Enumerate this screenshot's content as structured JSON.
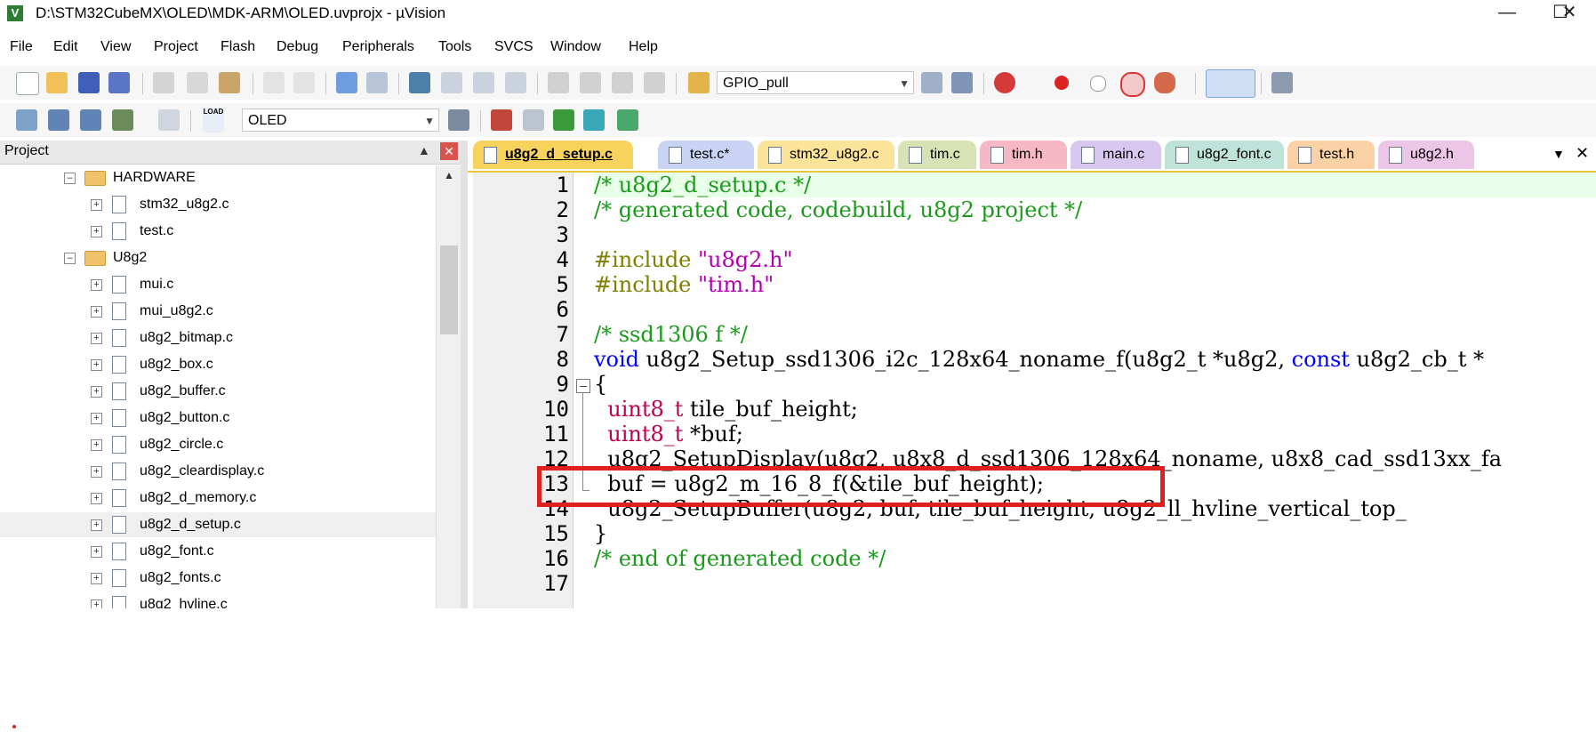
{
  "window": {
    "title": "D:\\STM32CubeMX\\OLED\\MDK-ARM\\OLED.uvprojx - µVision",
    "minimize": "—",
    "maximize": "☐",
    "close": "✕"
  },
  "menu": [
    "File",
    "Edit",
    "View",
    "Project",
    "Flash",
    "Debug",
    "Peripherals",
    "Tools",
    "SVCS",
    "Window",
    "Help"
  ],
  "toolbar1": {
    "find_combo": "GPIO_pull"
  },
  "toolbar2": {
    "target_combo": "OLED",
    "load_label": "LOAD"
  },
  "project_panel": {
    "title": "Project",
    "tree": [
      {
        "label": "HARDWARE",
        "type": "folder"
      },
      {
        "label": "stm32_u8g2.c",
        "type": "file"
      },
      {
        "label": "test.c",
        "type": "file"
      },
      {
        "label": "U8g2",
        "type": "folder"
      },
      {
        "label": "mui.c",
        "type": "file"
      },
      {
        "label": "mui_u8g2.c",
        "type": "file"
      },
      {
        "label": "u8g2_bitmap.c",
        "type": "file"
      },
      {
        "label": "u8g2_box.c",
        "type": "file"
      },
      {
        "label": "u8g2_buffer.c",
        "type": "file"
      },
      {
        "label": "u8g2_button.c",
        "type": "file"
      },
      {
        "label": "u8g2_circle.c",
        "type": "file"
      },
      {
        "label": "u8g2_cleardisplay.c",
        "type": "file"
      },
      {
        "label": "u8g2_d_memory.c",
        "type": "file"
      },
      {
        "label": "u8g2_d_setup.c",
        "type": "file",
        "selected": true
      },
      {
        "label": "u8g2_font.c",
        "type": "file"
      },
      {
        "label": "u8g2_fonts.c",
        "type": "file"
      },
      {
        "label": "u8g2_hvline.c",
        "type": "file"
      }
    ]
  },
  "tabs": [
    {
      "label": "u8g2_d_setup.c",
      "active": true,
      "color": "#f7d35e"
    },
    {
      "label": "test.c*",
      "color": "#c9d4f5"
    },
    {
      "label": "stm32_u8g2.c",
      "color": "#fbe39a"
    },
    {
      "label": "tim.c",
      "color": "#d7e3b5"
    },
    {
      "label": "tim.h",
      "color": "#f6b8c4"
    },
    {
      "label": "main.c",
      "color": "#d8c7ef"
    },
    {
      "label": "u8g2_font.c",
      "color": "#bfe3d8"
    },
    {
      "label": "test.h",
      "color": "#fbd1a6"
    },
    {
      "label": "u8g2.h",
      "color": "#ecc6e6"
    }
  ],
  "editor": {
    "line_numbers": [
      "1",
      "2",
      "3",
      "4",
      "5",
      "6",
      "7",
      "8",
      "9",
      "10",
      "11",
      "12",
      "13",
      "14",
      "15",
      "16",
      "17"
    ],
    "lines": {
      "l1": "/* u8g2_d_setup.c */",
      "l2": "/* generated code, codebuild, u8g2 project */",
      "l4a": "#include ",
      "l4b": "\"u8g2.h\"",
      "l5a": "#include ",
      "l5b": "\"tim.h\"",
      "l7": "/* ssd1306 f */",
      "l8a": "void",
      "l8b": " u8g2_Setup_ssd1306_i2c_128x64_noname_f(u8g2_t *u8g2, ",
      "l8c": "const",
      "l8d": " u8g2_cb_t *",
      "l9": "{",
      "l10a": "  uint8_t",
      "l10b": " tile_buf_height;",
      "l11a": "  uint8_t",
      "l11b": " *buf;",
      "l12": "  u8g2_SetupDisplay(u8g2, u8x8_d_ssd1306_128x64_noname, u8x8_cad_ssd13xx_fa",
      "l13": "  buf = u8g2_m_16_8_f(&tile_buf_height);",
      "l14": "  u8g2_SetupBuffer(u8g2, buf, tile_buf_height, u8g2_ll_hvline_vertical_top_",
      "l15": "}",
      "l16": "/* end of generated code */"
    }
  },
  "annotation_color": "#e0201e"
}
